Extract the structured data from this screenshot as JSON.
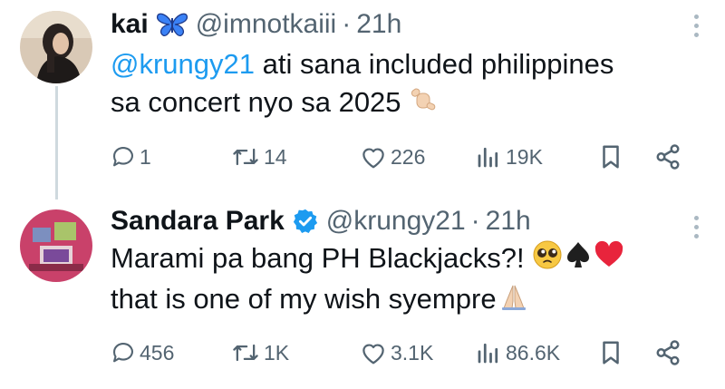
{
  "tweets": [
    {
      "name": "kai",
      "handle": "@imnotkaiii",
      "separator": "·",
      "time": "21h",
      "text": {
        "mention": "@krungy21",
        "line1_rest": " ati sana included philippines",
        "line2": "sa concert nyo sa 2025"
      },
      "emojis": [
        "butterfly",
        "call-me-hand"
      ],
      "stats": {
        "replies": "1",
        "reposts": "14",
        "likes": "226",
        "views": "19K"
      }
    },
    {
      "name": "Sandara Park",
      "verified": true,
      "handle": "@krungy21",
      "separator": "·",
      "time": "21h",
      "text": {
        "line1": "Marami pa bang PH Blackjacks?!",
        "line2": "that is one of my wish syempre"
      },
      "emojis": [
        "pleading-face",
        "spade",
        "red-heart",
        "folded-hands"
      ],
      "stats": {
        "replies": "456",
        "reposts": "1K",
        "likes": "3.1K",
        "views": "86.6K"
      }
    }
  ],
  "colors": {
    "text": "#0f1419",
    "secondary": "#536471",
    "mention": "#1d9bf0",
    "verified": "#1d9bf0",
    "thread_line": "#cfd9de"
  }
}
